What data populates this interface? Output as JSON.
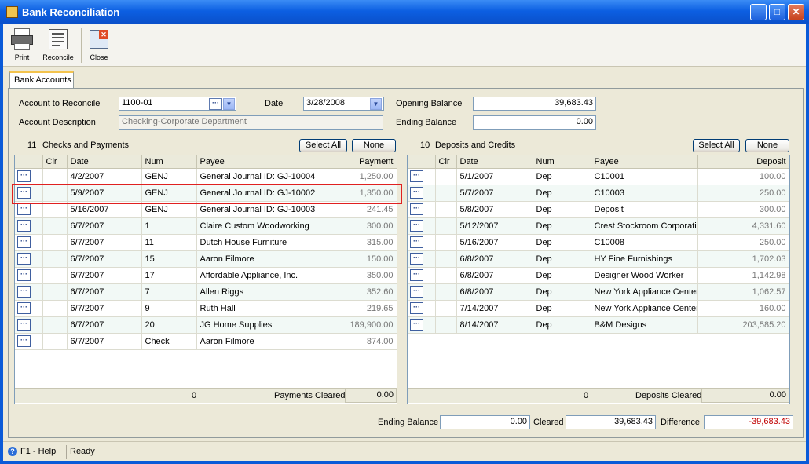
{
  "window": {
    "title": "Bank Reconciliation"
  },
  "toolbar": {
    "print": "Print",
    "reconcile": "Reconcile",
    "close": "Close"
  },
  "tabs": {
    "bank_accounts": "Bank Accounts"
  },
  "form": {
    "account_label": "Account to Reconcile",
    "account_value": "1100-01",
    "date_label": "Date",
    "date_value": "3/28/2008",
    "description_label": "Account Description",
    "description_value": "Checking-Corporate Department",
    "opening_balance_label": "Opening Balance",
    "opening_balance_value": "39,683.43",
    "ending_balance_label": "Ending Balance",
    "ending_balance_value": "0.00"
  },
  "checks": {
    "count": "11",
    "title": "Checks and Payments",
    "select_all": "Select All",
    "none": "None",
    "columns": {
      "clr": "Clr",
      "date": "Date",
      "num": "Num",
      "payee": "Payee",
      "amount": "Payment"
    },
    "rows": [
      {
        "date": "4/2/2007",
        "num": "GENJ",
        "payee": "General Journal ID: GJ-10004",
        "amount": "1,250.00"
      },
      {
        "date": "5/9/2007",
        "num": "GENJ",
        "payee": "General Journal ID: GJ-10002",
        "amount": "1,350.00"
      },
      {
        "date": "5/16/2007",
        "num": "GENJ",
        "payee": "General Journal ID: GJ-10003",
        "amount": "241.45"
      },
      {
        "date": "6/7/2007",
        "num": "1",
        "payee": "Claire Custom Woodworking",
        "amount": "300.00"
      },
      {
        "date": "6/7/2007",
        "num": "11",
        "payee": "Dutch House Furniture",
        "amount": "315.00"
      },
      {
        "date": "6/7/2007",
        "num": "15",
        "payee": "Aaron  Filmore",
        "amount": "150.00"
      },
      {
        "date": "6/7/2007",
        "num": "17",
        "payee": "Affordable Appliance, Inc.",
        "amount": "350.00"
      },
      {
        "date": "6/7/2007",
        "num": "7",
        "payee": "Allen Riggs",
        "amount": "352.60"
      },
      {
        "date": "6/7/2007",
        "num": "9",
        "payee": "Ruth Hall",
        "amount": "219.65"
      },
      {
        "date": "6/7/2007",
        "num": "20",
        "payee": "JG Home Supplies",
        "amount": "189,900.00"
      },
      {
        "date": "6/7/2007",
        "num": "Check",
        "payee": "Aaron  Filmore",
        "amount": "874.00"
      }
    ],
    "footer_count": "0",
    "footer_label": "Payments Cleared",
    "footer_value": "0.00"
  },
  "deposits": {
    "count": "10",
    "title": "Deposits and Credits",
    "select_all": "Select All",
    "none": "None",
    "columns": {
      "clr": "Clr",
      "date": "Date",
      "num": "Num",
      "payee": "Payee",
      "amount": "Deposit"
    },
    "rows": [
      {
        "date": "5/1/2007",
        "num": "Dep",
        "payee": "C10001",
        "amount": "100.00"
      },
      {
        "date": "5/7/2007",
        "num": "Dep",
        "payee": "C10003",
        "amount": "250.00"
      },
      {
        "date": "5/8/2007",
        "num": "Dep",
        "payee": "Deposit",
        "amount": "300.00"
      },
      {
        "date": "5/12/2007",
        "num": "Dep",
        "payee": "Crest Stockroom Corporatio",
        "amount": "4,331.60"
      },
      {
        "date": "5/16/2007",
        "num": "Dep",
        "payee": "C10008",
        "amount": "250.00"
      },
      {
        "date": "6/8/2007",
        "num": "Dep",
        "payee": "HY Fine Furnishings",
        "amount": "1,702.03"
      },
      {
        "date": "6/8/2007",
        "num": "Dep",
        "payee": "Designer Wood Worker",
        "amount": "1,142.98"
      },
      {
        "date": "6/8/2007",
        "num": "Dep",
        "payee": "New York Appliance Center",
        "amount": "1,062.57"
      },
      {
        "date": "7/14/2007",
        "num": "Dep",
        "payee": "New York Appliance Center",
        "amount": "160.00"
      },
      {
        "date": "8/14/2007",
        "num": "Dep",
        "payee": "B&M Designs",
        "amount": "203,585.20"
      }
    ],
    "footer_count": "0",
    "footer_label": "Deposits Cleared",
    "footer_value": "0.00"
  },
  "summary": {
    "ending_balance_label": "Ending Balance",
    "ending_balance_value": "0.00",
    "cleared_label": "Cleared",
    "cleared_value": "39,683.43",
    "difference_label": "Difference",
    "difference_value": "-39,683.43"
  },
  "status": {
    "help": "F1 - Help",
    "state": "Ready"
  },
  "colors": {
    "title_bar": "#0a5ad8",
    "highlight": "#e02020",
    "negative": "#c00000"
  }
}
